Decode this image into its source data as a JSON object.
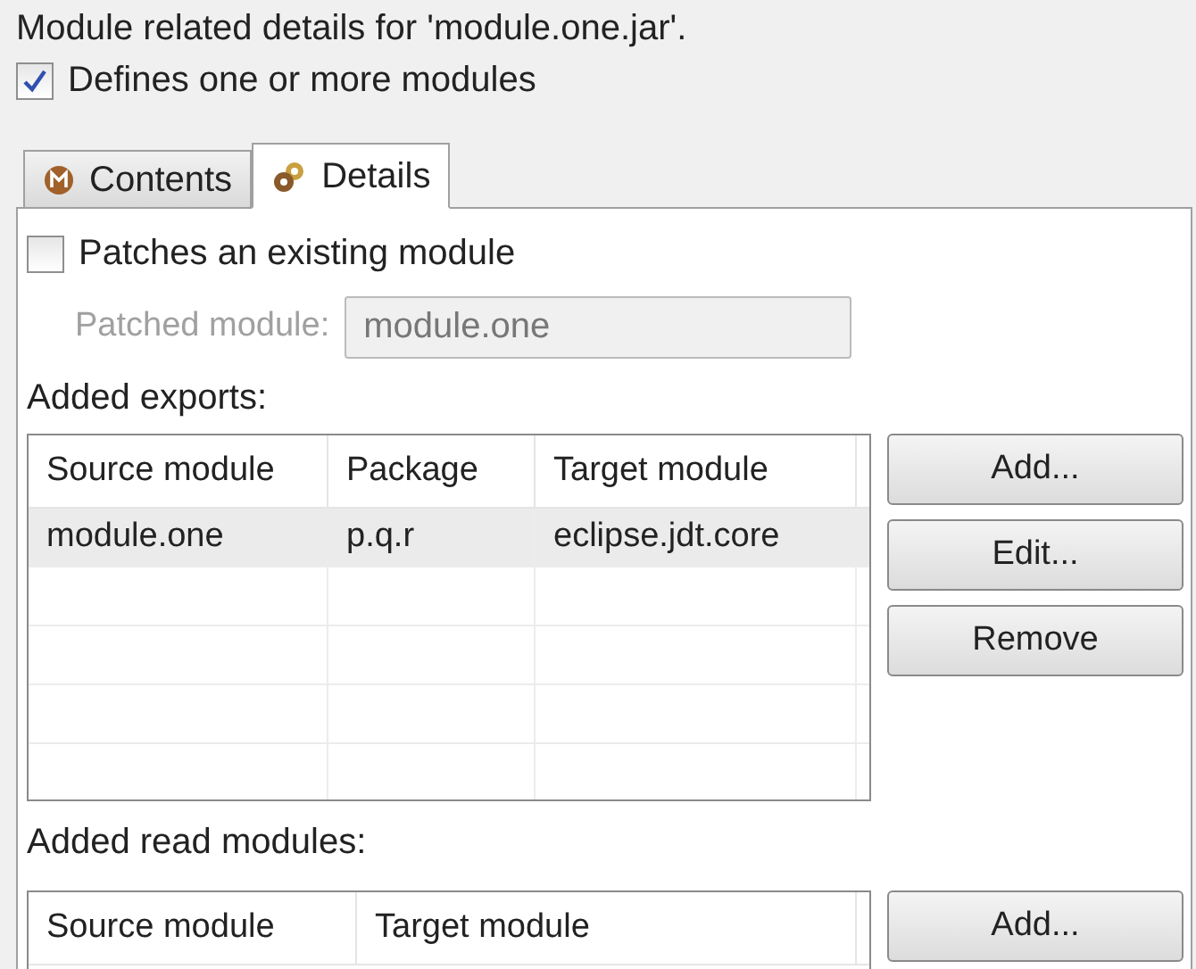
{
  "header": {
    "title": "Module related details for 'module.one.jar'."
  },
  "defines_modules": {
    "label": "Defines one or more modules",
    "checked": true
  },
  "tabs": [
    {
      "label": "Contents",
      "kind": "module",
      "selected": false
    },
    {
      "label": "Details",
      "kind": "details",
      "selected": true
    }
  ],
  "patch": {
    "label": "Patches an existing module",
    "checked": false,
    "field_label": "Patched module:",
    "field_value": "module.one",
    "disabled": true
  },
  "exports": {
    "title": "Added exports:",
    "columns": [
      "Source module",
      "Package",
      "Target module"
    ],
    "rows": [
      {
        "cells": [
          "module.one",
          "p.q.r",
          "eclipse.jdt.core"
        ],
        "selected": true
      }
    ],
    "buttons": [
      "Add...",
      "Edit...",
      "Remove"
    ]
  },
  "reads": {
    "title": "Added read modules:",
    "columns": [
      "Source module",
      "Target module"
    ],
    "buttons": [
      "Add..."
    ]
  }
}
